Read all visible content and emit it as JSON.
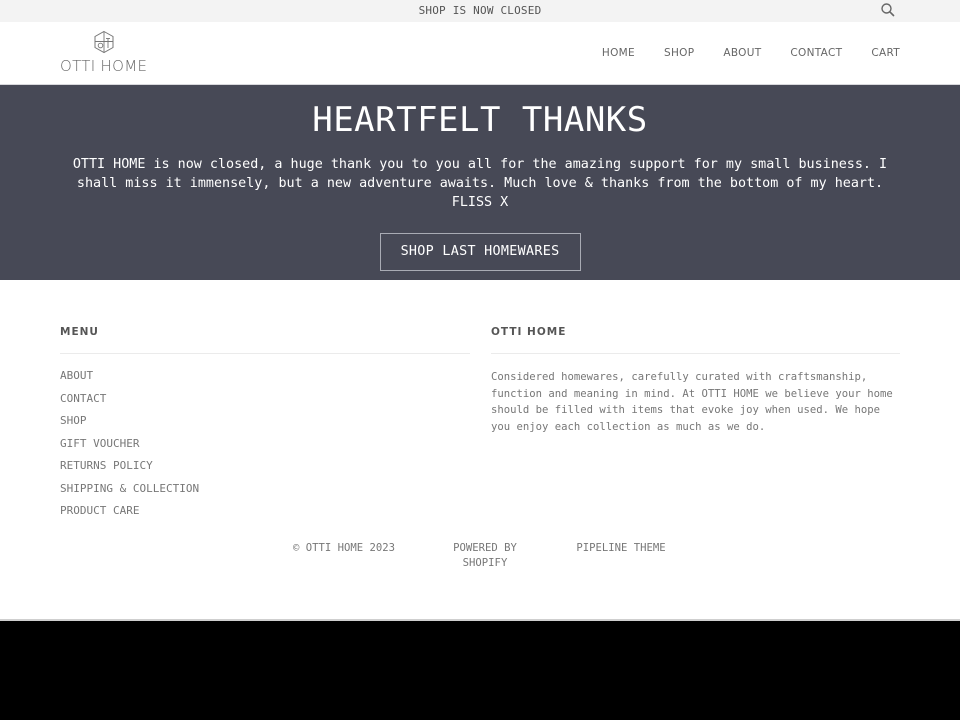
{
  "announcement": {
    "text": "SHOP IS NOW CLOSED",
    "search_icon": "search-icon"
  },
  "header": {
    "logo_text": "OTTI HOME",
    "logo_icon": "hexagon-monogram-icon",
    "nav": [
      {
        "label": "HOME"
      },
      {
        "label": "SHOP"
      },
      {
        "label": "ABOUT"
      },
      {
        "label": "CONTACT"
      },
      {
        "label": "CART"
      }
    ]
  },
  "hero": {
    "title": "HEARTFELT THANKS",
    "message": "OTTI HOME is now closed, a huge thank you to you all for the amazing support for my small business. I shall miss it immensely, but a new adventure awaits. Much love & thanks from the bottom of my heart. FLISS X",
    "cta_label": "SHOP LAST HOMEWARES",
    "background": "#474956"
  },
  "footer": {
    "menu": {
      "heading": "MENU",
      "items": [
        {
          "label": "ABOUT"
        },
        {
          "label": "CONTACT"
        },
        {
          "label": "SHOP"
        },
        {
          "label": "GIFT VOUCHER"
        },
        {
          "label": "RETURNS POLICY"
        },
        {
          "label": "SHIPPING & COLLECTION"
        },
        {
          "label": "PRODUCT CARE"
        }
      ]
    },
    "about": {
      "heading": "OTTI HOME",
      "text": "Considered homewares, carefully curated with craftsmanship, function and meaning in mind. At OTTI HOME we believe your home should be filled with items that evoke joy when used. We hope you enjoy each collection as much as we do."
    },
    "bottom": {
      "copyright": "© OTTI HOME 2023",
      "powered_by": "POWERED BY SHOPIFY",
      "theme": "PIPELINE THEME"
    }
  }
}
